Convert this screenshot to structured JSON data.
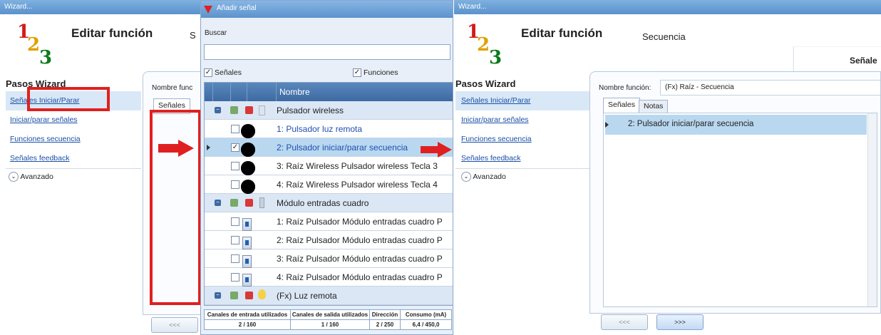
{
  "left_window": {
    "title": "Wizard...",
    "heading": "Editar función",
    "heading_trail": "S",
    "steps_title": "Pasos Wizard",
    "steps": [
      "Señales Iniciar/Parar",
      "Iniciar/parar señales",
      "Funciones secuencia",
      "Señales feedback"
    ],
    "advanced": "Avanzado",
    "function_name_label": "Nombre func",
    "tab": "Señales",
    "prev_button": "<<<"
  },
  "dialog": {
    "title": "Añadir señal",
    "search_label": "Buscar",
    "search_value": "",
    "filter_signals": "Señales",
    "filter_functions": "Funciones",
    "column_name": "Nombre",
    "groups": [
      {
        "name": "Pulsador wireless",
        "items": [
          {
            "label": "1: Pulsador luz remota",
            "checked": false
          },
          {
            "label": "2: Pulsador iniciar/parar secuencia",
            "checked": true
          },
          {
            "label": "3: Raíz Wireless Pulsador wireless Tecla 3",
            "checked": false
          },
          {
            "label": "4: Raíz Wireless Pulsador wireless Tecla 4",
            "checked": false
          }
        ]
      },
      {
        "name": "Módulo entradas cuadro",
        "items": [
          {
            "label": "1: Raíz Pulsador Módulo entradas cuadro P",
            "checked": false
          },
          {
            "label": "2: Raíz Pulsador Módulo entradas cuadro P",
            "checked": false
          },
          {
            "label": "3: Raíz Pulsador Módulo entradas cuadro P",
            "checked": false
          },
          {
            "label": "4: Raíz Pulsador Módulo entradas cuadro P",
            "checked": false
          }
        ]
      },
      {
        "name": "(Fx) Luz remota",
        "items": []
      }
    ],
    "footer_headers": [
      "Canales de entrada utilizados",
      "Canales de salida utilizados",
      "Dirección",
      "Consumo (mA)"
    ],
    "footer_values": [
      "2 / 160",
      "1 / 160",
      "2 / 250",
      "6,4 / 450,0"
    ]
  },
  "right_window": {
    "title": "Wizard...",
    "heading": "Editar función",
    "subheading": "Secuencia",
    "tab_header_right": "Señale",
    "steps_title": "Pasos Wizard",
    "steps": [
      "Señales Iniciar/Parar",
      "Iniciar/parar señales",
      "Funciones secuencia",
      "Señales feedback"
    ],
    "advanced": "Avanzado",
    "function_name_label": "Nombre función:",
    "function_name_value": "(Fx) Raíz - Secuencia",
    "tabs": [
      "Señales",
      "Notas"
    ],
    "list_items": [
      "2: Pulsador iniciar/parar secuencia"
    ],
    "prev_button": "<<<",
    "next_button": ">>>"
  },
  "logo_digits": [
    "1",
    "2",
    "3"
  ],
  "colors": {
    "accent_red": "#e02020",
    "selection": "#b9d8f0",
    "title_blue": "#5a92cc",
    "digit1": "#d11a1a",
    "digit2": "#e0a000",
    "digit3": "#0c7a1c"
  }
}
